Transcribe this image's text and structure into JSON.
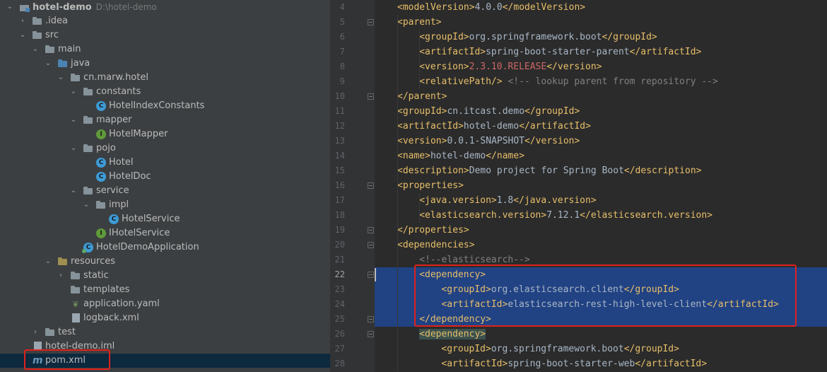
{
  "project_tree": {
    "project_name": "hotel-demo",
    "project_path": "D:\\hotel-demo",
    "items": [
      {
        "label": ".idea"
      },
      {
        "label": "src"
      },
      {
        "label": "main"
      },
      {
        "label": "java"
      },
      {
        "label": "cn.marw.hotel"
      },
      {
        "label": "constants"
      },
      {
        "label": "HotelIndexConstants"
      },
      {
        "label": "mapper"
      },
      {
        "label": "HotelMapper"
      },
      {
        "label": "pojo"
      },
      {
        "label": "Hotel"
      },
      {
        "label": "HotelDoc"
      },
      {
        "label": "service"
      },
      {
        "label": "impl"
      },
      {
        "label": "HotelService"
      },
      {
        "label": "IHotelService"
      },
      {
        "label": "HotelDemoApplication"
      },
      {
        "label": "resources"
      },
      {
        "label": "static"
      },
      {
        "label": "templates"
      },
      {
        "label": "application.yaml"
      },
      {
        "label": "logback.xml"
      },
      {
        "label": "test"
      },
      {
        "label": "hotel-demo.iml"
      },
      {
        "label": "pom.xml"
      }
    ],
    "icons": {
      "class_letter": "C",
      "interface_letter": "I",
      "maven_letter": "m"
    }
  },
  "editor": {
    "line_numbers": [
      "4",
      "5",
      "6",
      "7",
      "8",
      "9",
      "10",
      "11",
      "12",
      "13",
      "14",
      "15",
      "16",
      "17",
      "18",
      "19",
      "20",
      "21",
      "22",
      "23",
      "24",
      "25",
      "26",
      "27",
      "28"
    ],
    "lines": [
      {
        "p": [
          {
            "c": "t",
            "x": "<modelVersion>"
          },
          {
            "c": "v",
            "x": "4.0.0"
          },
          {
            "c": "t",
            "x": "</modelVersion>"
          }
        ]
      },
      {
        "p": [
          {
            "c": "t",
            "x": "<parent>"
          }
        ]
      },
      {
        "p": [
          {
            "c": "t",
            "x": "<groupId>"
          },
          {
            "c": "v",
            "x": "org.springframework.boot"
          },
          {
            "c": "t",
            "x": "</groupId>"
          }
        ]
      },
      {
        "p": [
          {
            "c": "t",
            "x": "<artifactId>"
          },
          {
            "c": "v",
            "x": "spring-boot-starter-parent"
          },
          {
            "c": "t",
            "x": "</artifactId>"
          }
        ]
      },
      {
        "p": [
          {
            "c": "t",
            "x": "<version>"
          },
          {
            "c": "red",
            "x": "2.3.10.RELEASE"
          },
          {
            "c": "t",
            "x": "</version>"
          }
        ]
      },
      {
        "p": [
          {
            "c": "t",
            "x": "<relativePath/>"
          },
          {
            "c": "cm",
            "x": " <!-- lookup parent from repository -->"
          }
        ]
      },
      {
        "p": [
          {
            "c": "t",
            "x": "</parent>"
          }
        ]
      },
      {
        "p": [
          {
            "c": "t",
            "x": "<groupId>"
          },
          {
            "c": "v",
            "x": "cn.itcast.demo"
          },
          {
            "c": "t",
            "x": "</groupId>"
          }
        ]
      },
      {
        "p": [
          {
            "c": "t",
            "x": "<artifactId>"
          },
          {
            "c": "v",
            "x": "hotel-demo"
          },
          {
            "c": "t",
            "x": "</artifactId>"
          }
        ]
      },
      {
        "p": [
          {
            "c": "t",
            "x": "<version>"
          },
          {
            "c": "v",
            "x": "0.0.1-SNAPSHOT"
          },
          {
            "c": "t",
            "x": "</version>"
          }
        ]
      },
      {
        "p": [
          {
            "c": "t",
            "x": "<name>"
          },
          {
            "c": "v",
            "x": "hotel-demo"
          },
          {
            "c": "t",
            "x": "</name>"
          }
        ]
      },
      {
        "p": [
          {
            "c": "t",
            "x": "<description>"
          },
          {
            "c": "v",
            "x": "Demo project for Spring Boot"
          },
          {
            "c": "t",
            "x": "</description>"
          }
        ]
      },
      {
        "p": [
          {
            "c": "t",
            "x": "<properties>"
          }
        ]
      },
      {
        "p": [
          {
            "c": "t",
            "x": "<java.version>"
          },
          {
            "c": "v",
            "x": "1.8"
          },
          {
            "c": "t",
            "x": "</java.version>"
          }
        ]
      },
      {
        "p": [
          {
            "c": "t",
            "x": "<elasticsearch.version>"
          },
          {
            "c": "v",
            "x": "7.12.1"
          },
          {
            "c": "t",
            "x": "</elasticsearch.version>"
          }
        ]
      },
      {
        "p": [
          {
            "c": "t",
            "x": "</properties>"
          }
        ]
      },
      {
        "p": [
          {
            "c": "t",
            "x": "<dependencies>"
          }
        ]
      },
      {
        "p": [
          {
            "c": "cm",
            "x": "<!--elasticsearch-->"
          }
        ]
      },
      {
        "p": [
          {
            "c": "t",
            "x": "<dependency>"
          }
        ]
      },
      {
        "p": [
          {
            "c": "t",
            "x": "<groupId>"
          },
          {
            "c": "v",
            "x": "org.elasticsearch.client"
          },
          {
            "c": "t",
            "x": "</groupId>"
          }
        ]
      },
      {
        "p": [
          {
            "c": "t",
            "x": "<artifactId>"
          },
          {
            "c": "v",
            "x": "elasticsearch-rest-high-level-client"
          },
          {
            "c": "t",
            "x": "</artifactId>"
          }
        ]
      },
      {
        "p": [
          {
            "c": "t",
            "x": "</dependency>"
          }
        ]
      },
      {
        "p": [
          {
            "c": "t hl",
            "x": "<dependency>"
          }
        ]
      },
      {
        "p": [
          {
            "c": "t",
            "x": "<groupId>"
          },
          {
            "c": "v",
            "x": "org.springframework.boot"
          },
          {
            "c": "t",
            "x": "</groupId>"
          }
        ]
      },
      {
        "p": [
          {
            "c": "t",
            "x": "<artifactId>"
          },
          {
            "c": "v",
            "x": "spring-boot-starter-web"
          },
          {
            "c": "t",
            "x": "</artifactId>"
          }
        ]
      }
    ]
  },
  "colors": {
    "tree_bg": "#3c3f41",
    "editor_bg": "#2b2b2b",
    "selection": "#214283",
    "xml_tag": "#e8bf6a",
    "annotation_box": "#e0211c"
  }
}
